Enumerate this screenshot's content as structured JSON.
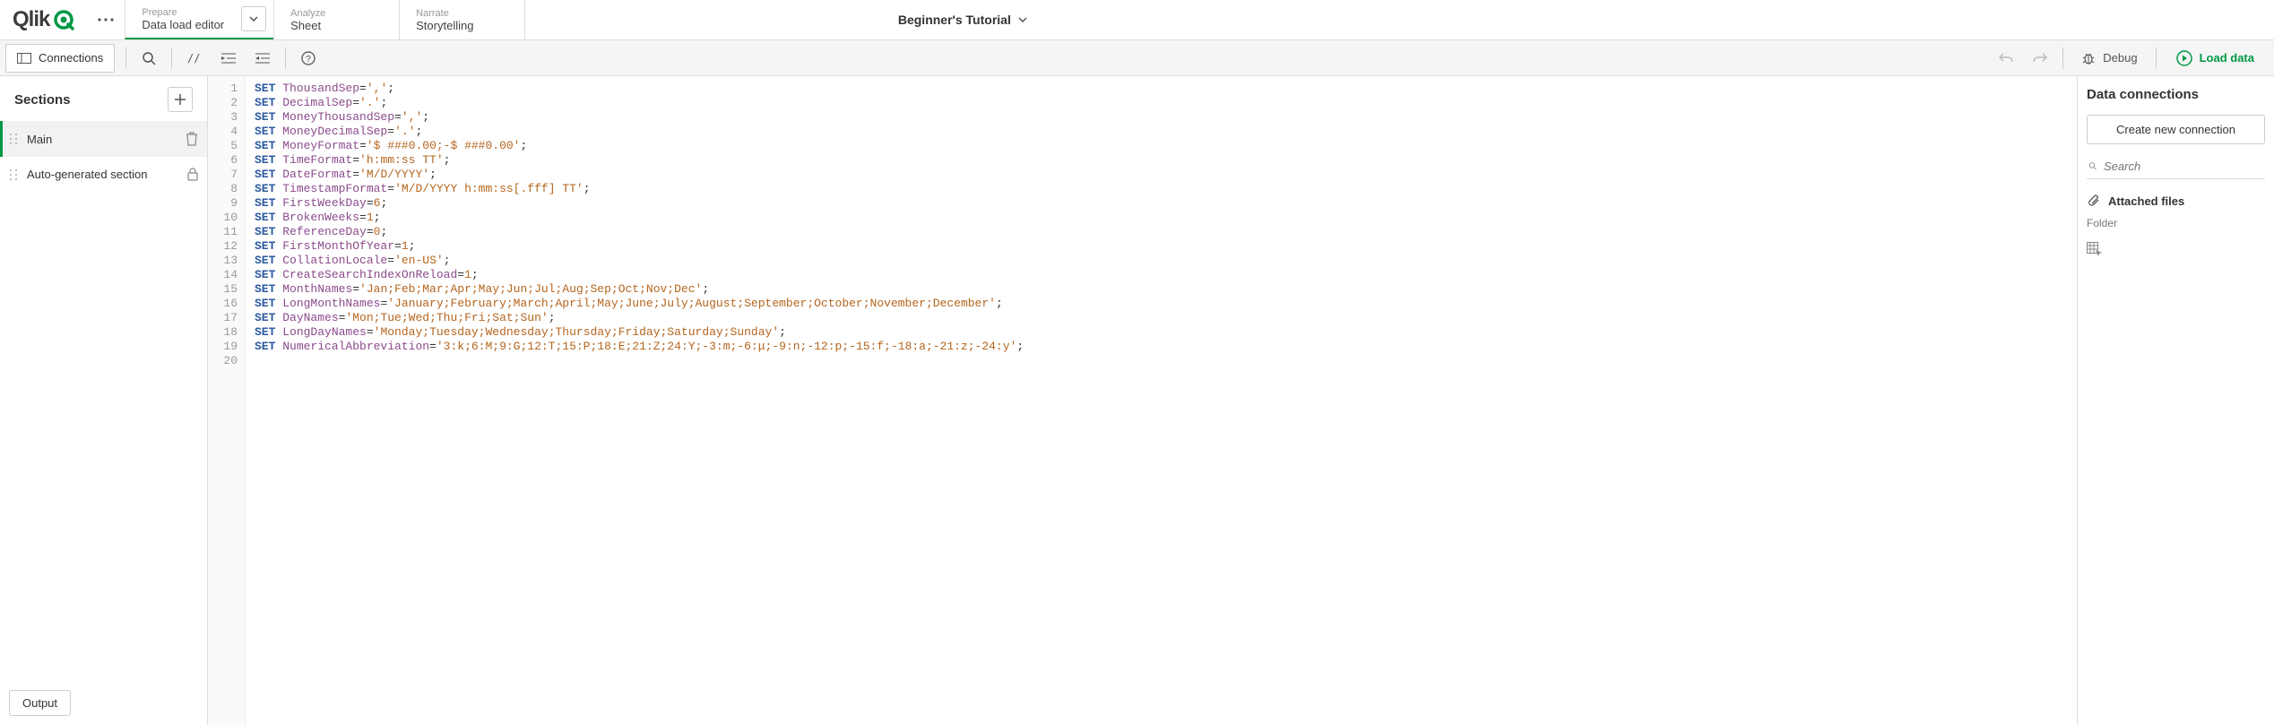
{
  "app": {
    "title": "Beginner's Tutorial",
    "logo_text": "Qlik"
  },
  "nav": {
    "prepare": {
      "sub": "Prepare",
      "main": "Data load editor"
    },
    "analyze": {
      "sub": "Analyze",
      "main": "Sheet"
    },
    "narrate": {
      "sub": "Narrate",
      "main": "Storytelling"
    }
  },
  "toolbar": {
    "connections": "Connections",
    "debug": "Debug",
    "load_data": "Load data"
  },
  "sections": {
    "header": "Sections",
    "items": [
      {
        "name": "Main",
        "active": true,
        "icon": "delete"
      },
      {
        "name": "Auto-generated section",
        "active": false,
        "icon": "lock"
      }
    ]
  },
  "code_lines": [
    {
      "n": 1,
      "kw": "SET",
      "var": "ThousandSep",
      "rest": "=",
      "str": "','",
      "tail": ";"
    },
    {
      "n": 2,
      "kw": "SET",
      "var": "DecimalSep",
      "rest": "=",
      "str": "'.'",
      "tail": ";"
    },
    {
      "n": 3,
      "kw": "SET",
      "var": "MoneyThousandSep",
      "rest": "=",
      "str": "','",
      "tail": ";"
    },
    {
      "n": 4,
      "kw": "SET",
      "var": "MoneyDecimalSep",
      "rest": "=",
      "str": "'.'",
      "tail": ";"
    },
    {
      "n": 5,
      "kw": "SET",
      "var": "MoneyFormat",
      "rest": "=",
      "str": "'$ ###0.00;-$ ###0.00'",
      "tail": ";"
    },
    {
      "n": 6,
      "kw": "SET",
      "var": "TimeFormat",
      "rest": "=",
      "str": "'h:mm:ss TT'",
      "tail": ";"
    },
    {
      "n": 7,
      "kw": "SET",
      "var": "DateFormat",
      "rest": "=",
      "str": "'M/D/YYYY'",
      "tail": ";"
    },
    {
      "n": 8,
      "kw": "SET",
      "var": "TimestampFormat",
      "rest": "=",
      "str": "'M/D/YYYY h:mm:ss[.fff] TT'",
      "tail": ";"
    },
    {
      "n": 9,
      "kw": "SET",
      "var": "FirstWeekDay",
      "rest": "=",
      "num": "6",
      "tail": ";"
    },
    {
      "n": 10,
      "kw": "SET",
      "var": "BrokenWeeks",
      "rest": "=",
      "num": "1",
      "tail": ";"
    },
    {
      "n": 11,
      "kw": "SET",
      "var": "ReferenceDay",
      "rest": "=",
      "num": "0",
      "tail": ";"
    },
    {
      "n": 12,
      "kw": "SET",
      "var": "FirstMonthOfYear",
      "rest": "=",
      "num": "1",
      "tail": ";"
    },
    {
      "n": 13,
      "kw": "SET",
      "var": "CollationLocale",
      "rest": "=",
      "str": "'en-US'",
      "tail": ";"
    },
    {
      "n": 14,
      "kw": "SET",
      "var": "CreateSearchIndexOnReload",
      "rest": "=",
      "num": "1",
      "tail": ";"
    },
    {
      "n": 15,
      "kw": "SET",
      "var": "MonthNames",
      "rest": "=",
      "str": "'Jan;Feb;Mar;Apr;May;Jun;Jul;Aug;Sep;Oct;Nov;Dec'",
      "tail": ";"
    },
    {
      "n": 16,
      "kw": "SET",
      "var": "LongMonthNames",
      "rest": "=",
      "str": "'January;February;March;April;May;June;July;August;September;October;November;December'",
      "tail": ";"
    },
    {
      "n": 17,
      "kw": "SET",
      "var": "DayNames",
      "rest": "=",
      "str": "'Mon;Tue;Wed;Thu;Fri;Sat;Sun'",
      "tail": ";"
    },
    {
      "n": 18,
      "kw": "SET",
      "var": "LongDayNames",
      "rest": "=",
      "str": "'Monday;Tuesday;Wednesday;Thursday;Friday;Saturday;Sunday'",
      "tail": ";"
    },
    {
      "n": 19,
      "kw": "SET",
      "var": "NumericalAbbreviation",
      "rest": "=",
      "str": "'3:k;6:M;9:G;12:T;15:P;18:E;21:Z;24:Y;-3:m;-6:μ;-9:n;-12:p;-15:f;-18:a;-21:z;-24:y'",
      "tail": ";"
    },
    {
      "n": 20
    }
  ],
  "connections": {
    "header": "Data connections",
    "create": "Create new connection",
    "search_placeholder": "Search",
    "attached": "Attached files",
    "folder": "Folder"
  },
  "output": "Output"
}
